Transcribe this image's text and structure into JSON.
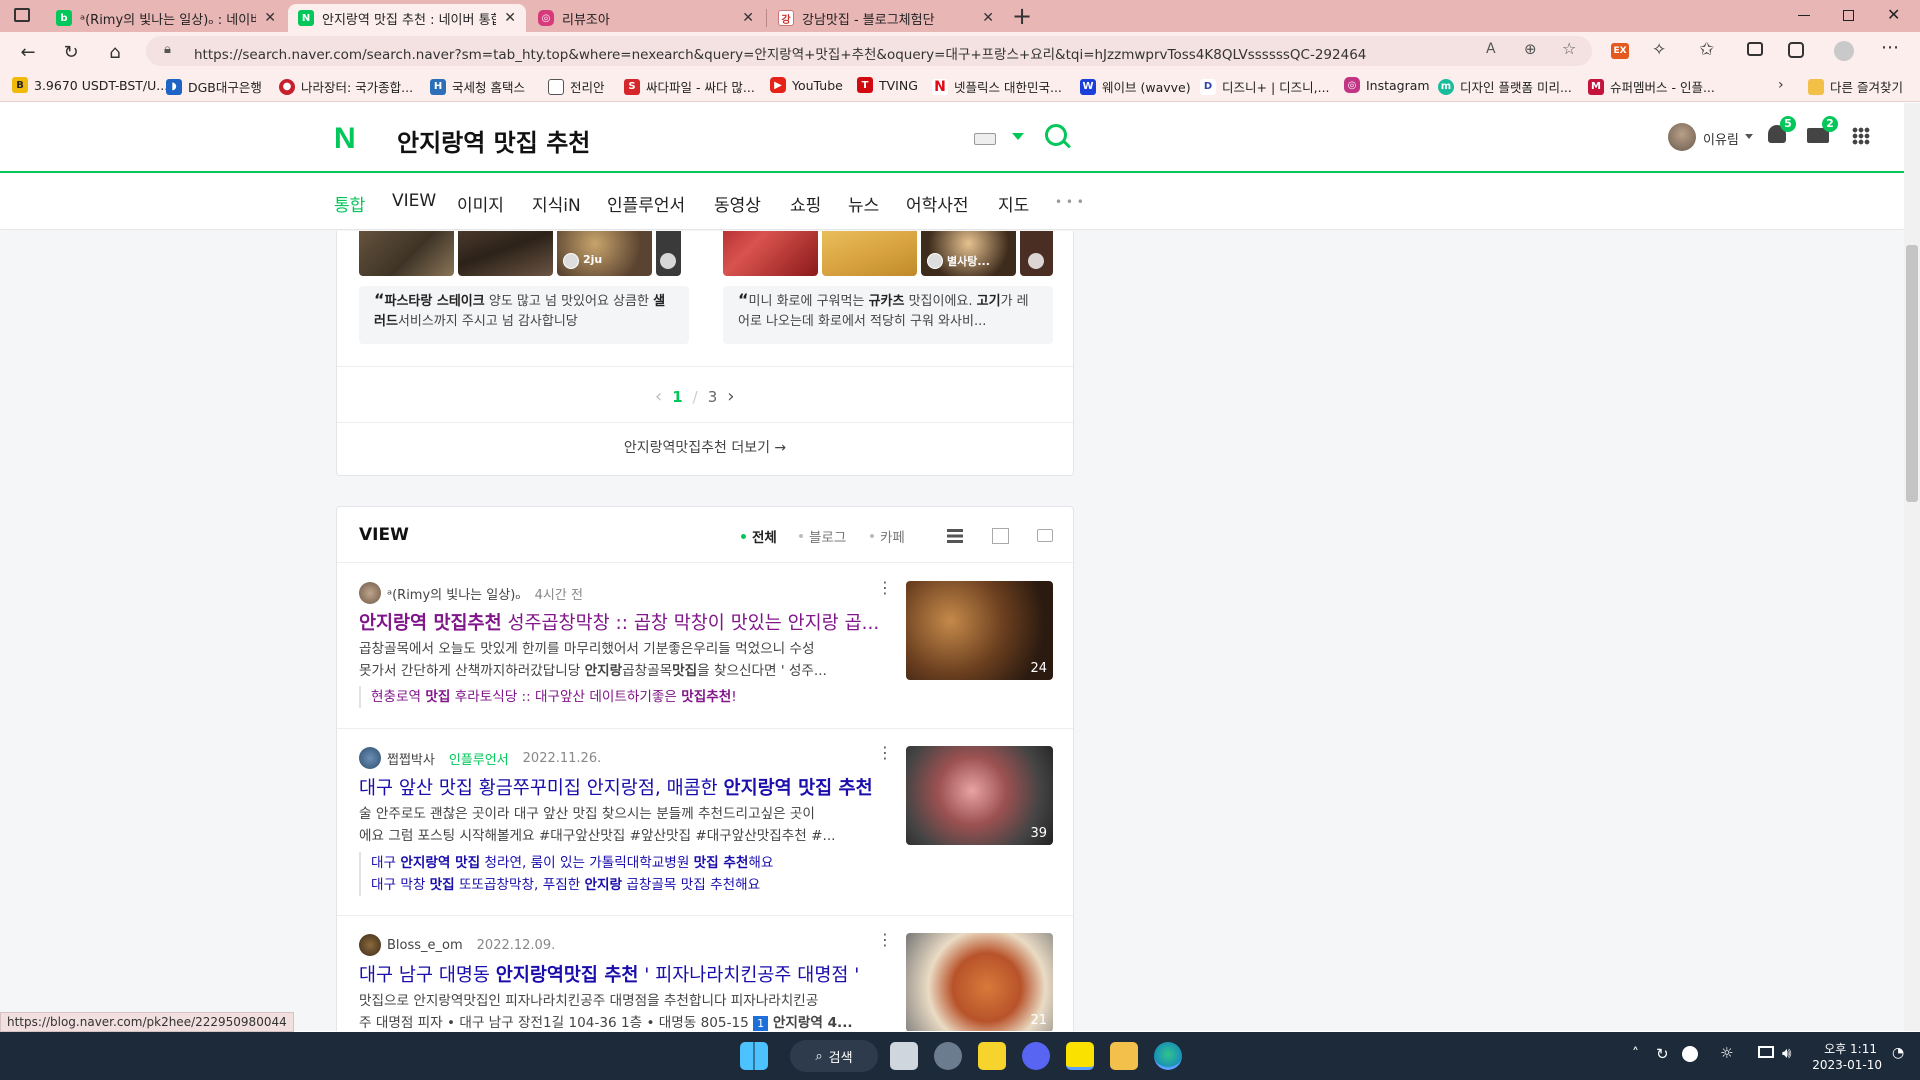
{
  "browser": {
    "tabs": [
      {
        "title": "ᵃ(Rimy의 빛나는 일상)ₒ : 네이버",
        "favicon": "naver-blog"
      },
      {
        "title": "안지랑역 맛집 추천 : 네이버 통합",
        "favicon": "naver"
      },
      {
        "title": "리뷰조아",
        "favicon": "instagram"
      },
      {
        "title": "강남맛집 - 블로그체험단",
        "favicon": "gangnam"
      }
    ],
    "new_tab": "+",
    "url": "https://search.naver.com/search.naver?sm=tab_hty.top&where=nexearch&query=안지랑역+맛집+추천&oquery=대구+프랑스+요리&tqi=hJzzmwprvToss4K8QLVssssssQC-292464",
    "bookmarks": [
      "3.9670 USDT-BST/U...",
      "DGB대구은행",
      "나라장터: 국가종합...",
      "국세청 홈택스",
      "전리안",
      "싸다파일 - 싸다 많...",
      "YouTube",
      "TVING",
      "넷플릭스 대한민국...",
      "웨이브 (wavve)",
      "디즈니+ | 디즈니,...",
      "Instagram",
      "디자인 플랫폼 미리...",
      "슈퍼멤버스 - 인플..."
    ],
    "other_favorites": "다른 즐겨찾기",
    "status_url": "https://blog.naver.com/pk2hee/222950980044"
  },
  "naver": {
    "logo": "N",
    "query": "안지랑역 맛집 추천",
    "user_name": "이유림",
    "notification_count": "5",
    "mail_count": "2",
    "tabs": [
      "통합",
      "VIEW",
      "이미지",
      "지식iN",
      "인플루언서",
      "동영상",
      "쇼핑",
      "뉴스",
      "어학사전",
      "지도"
    ],
    "more_tabs": "• • •"
  },
  "top_card": {
    "left_badge_name": "2ju",
    "right_badge_name": "별사탕...",
    "left_quote": {
      "pre": "",
      "b1": "파스타랑 스테이크",
      "m1": " 양도 많고 넘 맛있어요 상큼한 ",
      "b2": "샐러드",
      "m2": "서비스까지 주시고 넘 감사합니당"
    },
    "right_quote": {
      "pre": "미니 화로에 구워먹는 ",
      "b1": "규카츠",
      "m1": " 맛집이에요. ",
      "b2": "고기",
      "m2": "가 레어로 나오는데 화로에서 적당히 구워 와사비..."
    },
    "page_current": "1",
    "page_sep": "/",
    "page_total": "3",
    "more_link": "안지랑역맛집추천 더보기 →"
  },
  "view_section": {
    "title": "VIEW",
    "filters": [
      "전체",
      "블로그",
      "카페"
    ],
    "posts": [
      {
        "author": "ᵃ(Rimy의 빛나는 일상)ₒ",
        "time": "4시간 전",
        "title_bold": "안지랑역 맛집추천",
        "title_rest": " 성주곱창막창 :: 곱창 막창이 맛있는 안지랑 곱...",
        "desc_1": "곱창골목에서 오늘도 맛있게 한끼를 마무리했어서 기분좋은우리들 먹었으니 수성",
        "desc_2": "못가서 간단하게 산책까지하러갔답니당 ",
        "desc_2b": "안지랑",
        "desc_2c": "곱창골목",
        "desc_2d": "맛집",
        "desc_2e": "을 찾으신다면 ' 성주...",
        "sub_links": [
          {
            "p1": "현충로역 ",
            "b1": "맛집",
            "p2": " 후라토식당 :: 대구앞산 데이트하기좋은 ",
            "b2": "맛집추천",
            "p3": "!"
          }
        ],
        "image_count": "24",
        "visited": true
      },
      {
        "author": "쩝쩝박사",
        "badge": "인플루언서",
        "time": "2022.11.26.",
        "title_plain": "대구 앞산 맛집 황금쭈꾸미집 안지랑점, 매콤한 ",
        "title_bold": "안지랑역 맛집 추천",
        "desc_1": "술 안주로도 괜찮은 곳이라 대구 앞산 맛집 찾으시는 분들께 추천드리고싶은 곳이",
        "desc_2": "에요 그럼 포스팅 시작해볼게요 #대구앞산맛집 #앞산맛집 #대구앞산맛집추천 #...",
        "sub_links": [
          {
            "p1": "대구 ",
            "b1": "안지랑역 맛집",
            "p2": " 청라연, 룸이 있는 가톨릭대학교병원 ",
            "b2": "맛집 추천",
            "p3": "해요"
          },
          {
            "p1": "대구 막창 ",
            "b1": "맛집",
            "p2": " 또또곱창막창, 푸짐한 ",
            "b2": "안지랑",
            "p3": " 곱창골목 맛집 추천해요"
          }
        ],
        "image_count": "39"
      },
      {
        "author": "Bloss_e_om",
        "time": "2022.12.09.",
        "title_plain": "대구 남구 대명동 ",
        "title_bold": "안지랑역맛집 추천",
        "title_rest": " ' 피자나라치킨공주 대명점 '",
        "desc_1": "맛집으로 안지랑역맛집인 피자나라치킨공주 대명점을 추천합니다 피자나라치킨공",
        "desc_2": "주 대명점 피자 • 대구 남구 장전1길 104-36 1층 • 대명동 805-15 ",
        "desc_2b": "1",
        "desc_2c": " 안지랑역 4...",
        "image_count": "21"
      }
    ]
  },
  "taskbar": {
    "search_label": "검색",
    "time": "오후 1:11",
    "date": "2023-01-10"
  },
  "colors": {
    "naver_green": "#03c75a",
    "tab_strip": "#e8b6b5",
    "link_blue": "#1a0dab",
    "visited_purple": "#80168a"
  }
}
